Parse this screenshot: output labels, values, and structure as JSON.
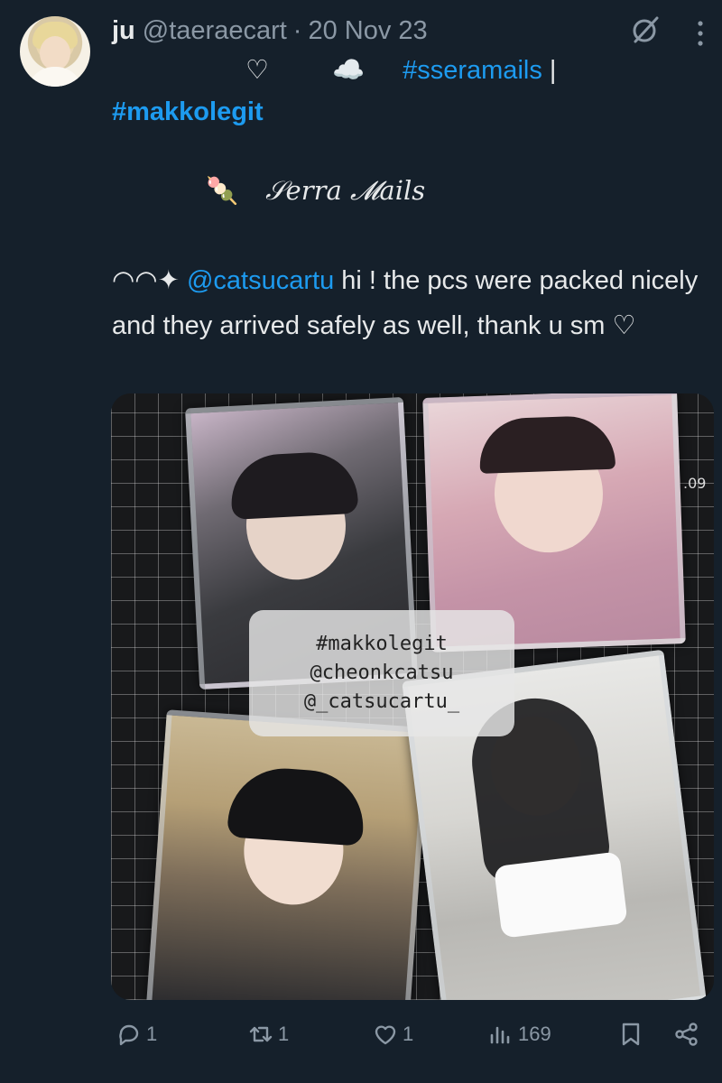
{
  "author": {
    "name": "ju",
    "handle": "@taeraecart",
    "separator": "·",
    "date": "20 Nov 23"
  },
  "icons": {
    "grok": "grok-icon",
    "more": "more-vertical-icon"
  },
  "tweet": {
    "line1": {
      "heart": "♡",
      "cloud": "☁️",
      "hashtag": "#sseramails",
      "divider": "|"
    },
    "line2": {
      "hashtag": "#makkolegit"
    },
    "brand": {
      "emoji": "🍡",
      "text": "𝒮erra 𝓜ails"
    },
    "body": {
      "prefix": "◠◠✦",
      "mention": "@catsucartu",
      "text": " hi ! the pcs were packed nicely and they arrived safely as well, thank u sm  ♡"
    }
  },
  "photo": {
    "watermark": [
      "#makkolegit",
      "@cheonkcatsu",
      "@_catsucartu_"
    ],
    "mat_mark": ".09"
  },
  "actions": {
    "replies": "1",
    "reposts": "1",
    "likes": "1",
    "views": "169"
  }
}
